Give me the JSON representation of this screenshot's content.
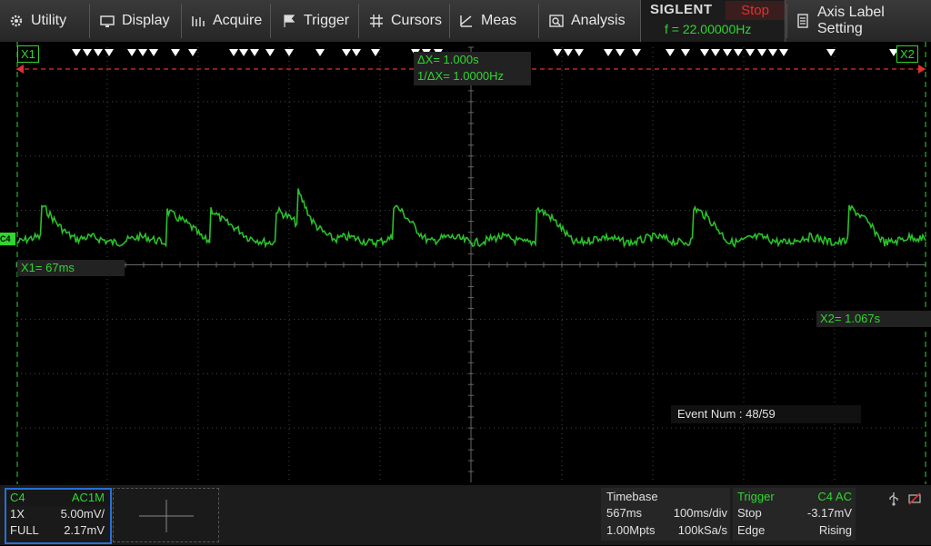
{
  "menu": {
    "utility": "Utility",
    "display": "Display",
    "acquire": "Acquire",
    "trigger": "Trigger",
    "cursors": "Cursors",
    "meas": "Meas",
    "analysis": "Analysis",
    "axis_label": "Axis Label Setting"
  },
  "brand": {
    "logo": "SIGLENT",
    "run_state": "Stop",
    "frequency": "f = 22.00000Hz"
  },
  "cursors": {
    "x1_tag": "X1",
    "x2_tag": "X2",
    "delta_x": "ΔX= 1.000s",
    "inv_delta_x": "1/ΔX= 1.0000Hz",
    "x1_value": "X1= 67ms",
    "x2_value": "X2= 1.067s"
  },
  "event": "Event Num : 48/59",
  "channel": {
    "marker": "C4",
    "name": "C4",
    "coupling": "AC1M",
    "probe": "1X",
    "scale": "5.00mV/",
    "bandwidth": "FULL",
    "offset": "2.17mV",
    "color": "#2fd62f"
  },
  "timebase": {
    "title": "Timebase",
    "delay": "567ms",
    "scale": "100ms/div",
    "memory": "1.00Mpts",
    "sample_rate": "100kSa/s"
  },
  "trigger": {
    "title": "Trigger",
    "source": "C4 AC",
    "mode": "Stop",
    "level": "-3.17mV",
    "type": "Edge",
    "slope": "Rising"
  },
  "colors": {
    "trace": "#2fd62f",
    "grid": "#444444",
    "cursor_line": "#2fd62f",
    "trigger_line": "#e03030",
    "selection_border": "#2a6fd6"
  }
}
